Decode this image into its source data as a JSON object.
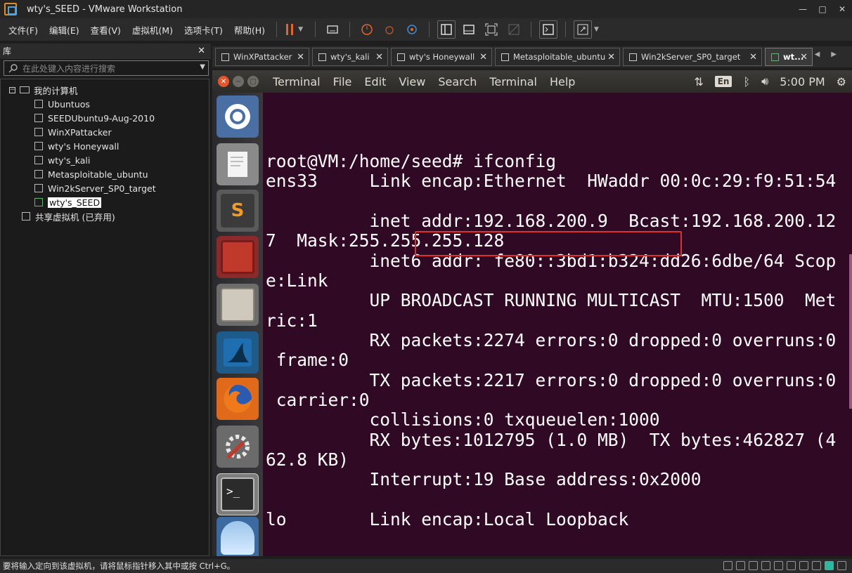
{
  "window": {
    "title": "wty's_SEED - VMware Workstation",
    "controls": [
      "—",
      "□",
      "✕"
    ]
  },
  "menu": [
    "文件(F)",
    "编辑(E)",
    "查看(V)",
    "虚拟机(M)",
    "选项卡(T)",
    "帮助(H)"
  ],
  "library": {
    "title": "库",
    "search_placeholder": "在此处键入内容进行搜索",
    "root": "我的计算机",
    "vms": [
      "Ubuntuos",
      "SEEDUbuntu9-Aug-2010",
      "WinXPattacker",
      "wty's Honeywall",
      "wty's_kali",
      "Metasploitable_ubuntu",
      "Win2kServer_SP0_target",
      "wty's_SEED"
    ],
    "shared": "共享虚拟机 (已弃用)"
  },
  "tabs": [
    "WinXPattacker",
    "wty's_kali",
    "wty's Honeywall",
    "Metasploitable_ubuntu",
    "Win2kServer_SP0_target",
    "wt..."
  ],
  "ubuntu": {
    "menus": [
      "Terminal",
      "File",
      "Edit",
      "View",
      "Search",
      "Terminal",
      "Help"
    ],
    "lang": "En",
    "time": "5:00 PM"
  },
  "terminal": {
    "lines": [
      "root@VM:/home/seed# ifconfig",
      "ens33     Link encap:Ethernet  HWaddr 00:0c:29:f9:51:54",
      "",
      "          inet addr:192.168.200.9  Bcast:192.168.200.12",
      "7  Mask:255.255.255.128",
      "          inet6 addr: fe80::3bd1:b324:dd26:6dbe/64 Scop",
      "e:Link",
      "          UP BROADCAST RUNNING MULTICAST  MTU:1500  Met",
      "ric:1",
      "          RX packets:2274 errors:0 dropped:0 overruns:0",
      " frame:0",
      "          TX packets:2217 errors:0 dropped:0 overruns:0",
      " carrier:0",
      "          collisions:0 txqueuelen:1000",
      "          RX bytes:1012795 (1.0 MB)  TX bytes:462827 (4",
      "62.8 KB)",
      "          Interrupt:19 Base address:0x2000",
      "",
      "lo        Link encap:Local Loopback"
    ]
  },
  "status": {
    "message": "要将输入定向到该虚拟机，请将鼠标指针移入其中或按 Ctrl+G。"
  },
  "colors": {
    "terminal_bg": "#300a24",
    "highlight": "#e0302c",
    "accent": "#e9622a"
  }
}
